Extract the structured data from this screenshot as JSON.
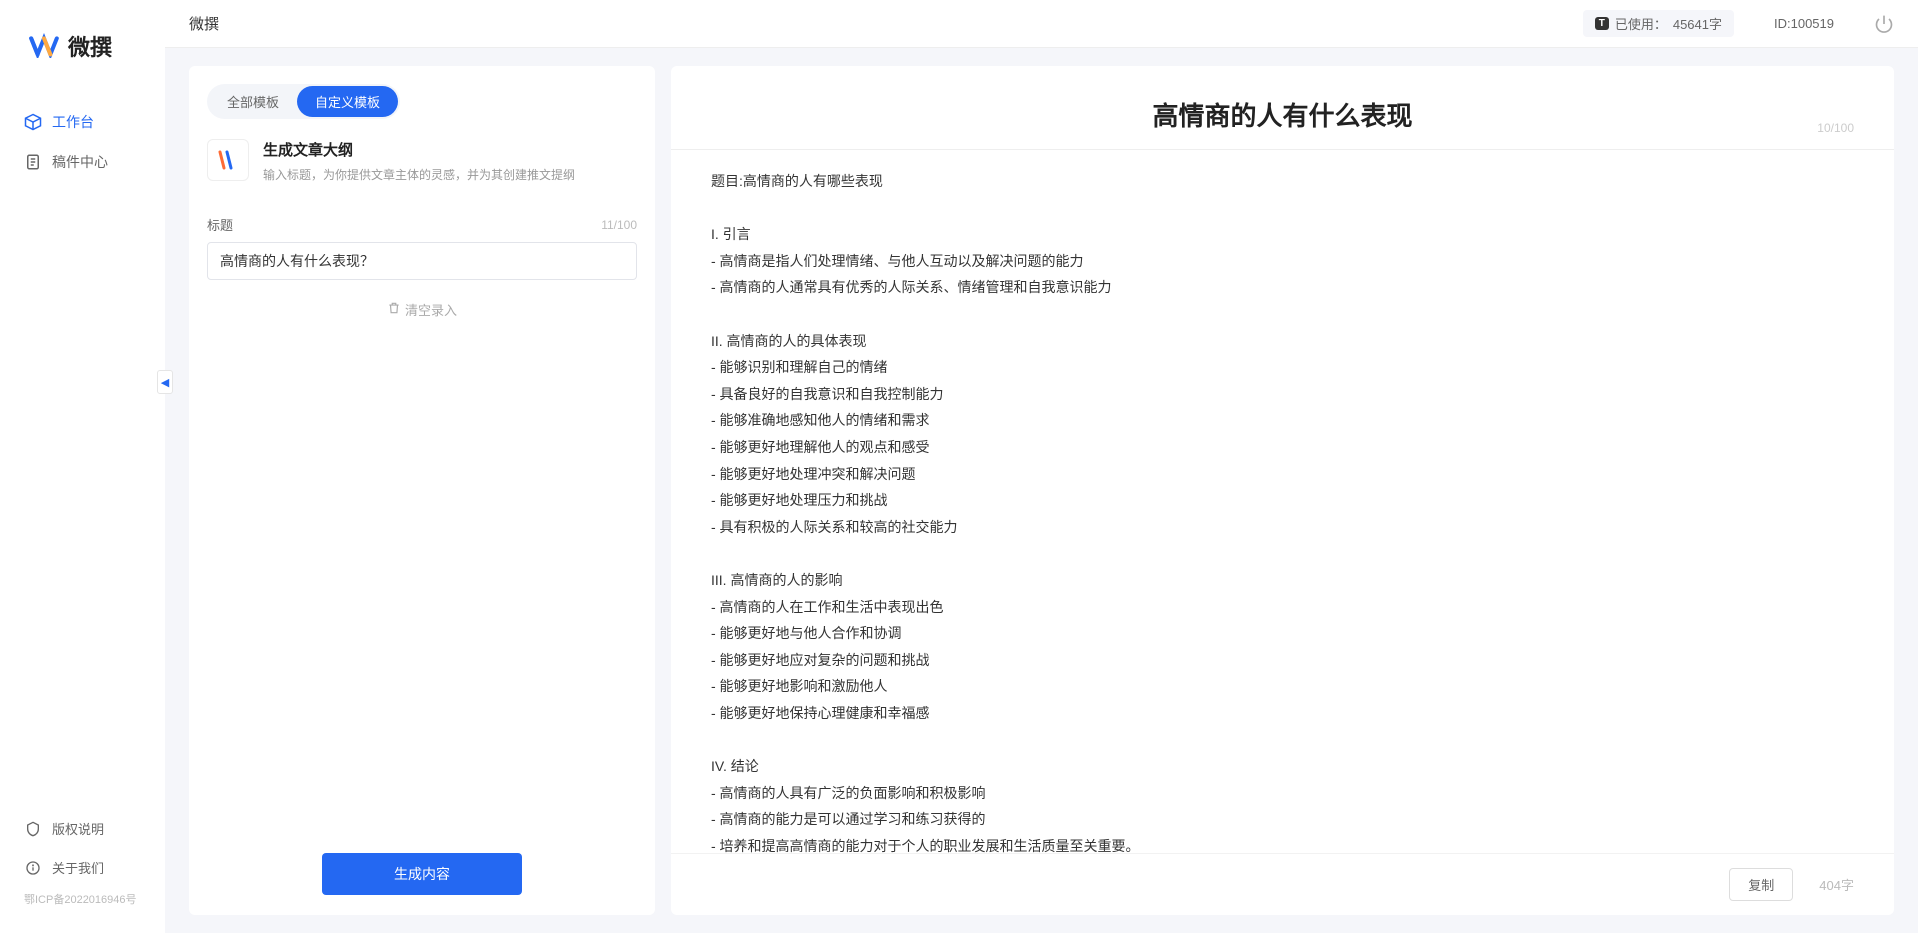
{
  "app": {
    "logo_text": "微撰",
    "topbar_title": "微撰"
  },
  "sidebar": {
    "nav": [
      {
        "label": "工作台",
        "icon": "cube"
      },
      {
        "label": "稿件中心",
        "icon": "doc"
      }
    ],
    "bottom": [
      {
        "label": "版权说明",
        "icon": "shield"
      },
      {
        "label": "关于我们",
        "icon": "info"
      }
    ],
    "icp": "鄂ICP备2022016946号"
  },
  "topbar": {
    "usage_prefix": "已使用：",
    "usage_value": "45641字",
    "usage_badge": "T",
    "id_label": "ID:100519"
  },
  "left": {
    "tabs": [
      "全部模板",
      "自定义模板"
    ],
    "active_tab": 1,
    "template": {
      "title": "生成文章大纲",
      "desc": "输入标题，为你提供文章主体的灵感，并为其创建推文提纲"
    },
    "field": {
      "label": "标题",
      "counter": "11/100",
      "value": "高情商的人有什么表现？"
    },
    "clear": "清空录入",
    "generate": "生成内容"
  },
  "right": {
    "title": "高情商的人有什么表现",
    "title_counter": "10/100",
    "body": "题目:高情商的人有哪些表现\n\nI. 引言\n- 高情商是指人们处理情绪、与他人互动以及解决问题的能力\n- 高情商的人通常具有优秀的人际关系、情绪管理和自我意识能力\n\nII. 高情商的人的具体表现\n- 能够识别和理解自己的情绪\n- 具备良好的自我意识和自我控制能力\n- 能够准确地感知他人的情绪和需求\n- 能够更好地理解他人的观点和感受\n- 能够更好地处理冲突和解决问题\n- 能够更好地处理压力和挑战\n- 具有积极的人际关系和较高的社交能力\n\nIII. 高情商的人的影响\n- 高情商的人在工作和生活中表现出色\n- 能够更好地与他人合作和协调\n- 能够更好地应对复杂的问题和挑战\n- 能够更好地影响和激励他人\n- 能够更好地保持心理健康和幸福感\n\nIV. 结论\n- 高情商的人具有广泛的负面影响和积极影响\n- 高情商的能力是可以通过学习和练习获得的\n- 培养和提高高情商的能力对于个人的职业发展和生活质量至关重要。",
    "copy": "复制",
    "word_count": "404字"
  }
}
